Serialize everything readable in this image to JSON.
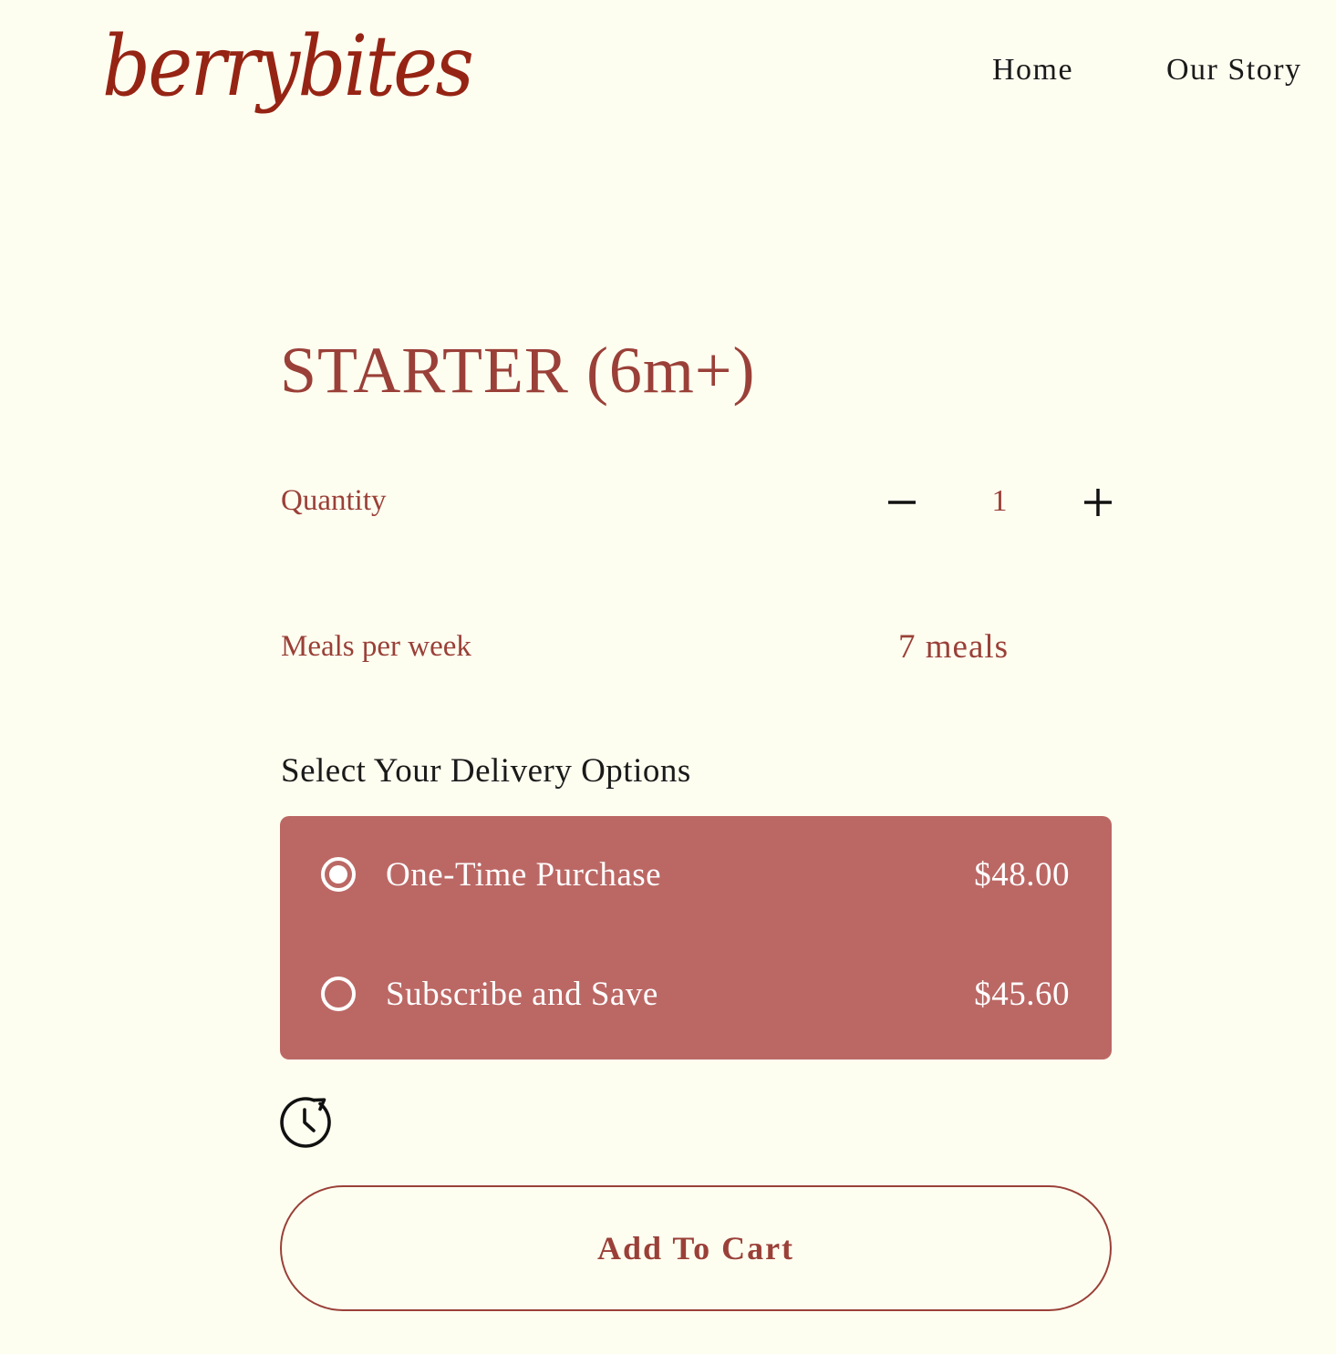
{
  "header": {
    "logo": "berrybites",
    "nav": [
      {
        "label": "Home"
      },
      {
        "label": "Our Story"
      }
    ]
  },
  "product": {
    "title": "STARTER (6m+)",
    "quantity": {
      "label": "Quantity",
      "value": "1"
    },
    "meals": {
      "label": "Meals per week",
      "value": "7 meals"
    }
  },
  "delivery": {
    "heading": "Select Your Delivery Options",
    "options": [
      {
        "label": "One-Time Purchase",
        "price": "$48.00",
        "selected": true
      },
      {
        "label": "Subscribe and Save",
        "price": "$45.60",
        "selected": false
      }
    ]
  },
  "cart": {
    "button_label": "Add To Cart"
  },
  "colors": {
    "background": "#fefef0",
    "brand": "#962414",
    "accent": "#9a4038",
    "panel": "#bb6865"
  },
  "icons": {
    "quantity_minus": "minus-icon",
    "quantity_plus": "plus-icon",
    "history": "history-icon"
  }
}
